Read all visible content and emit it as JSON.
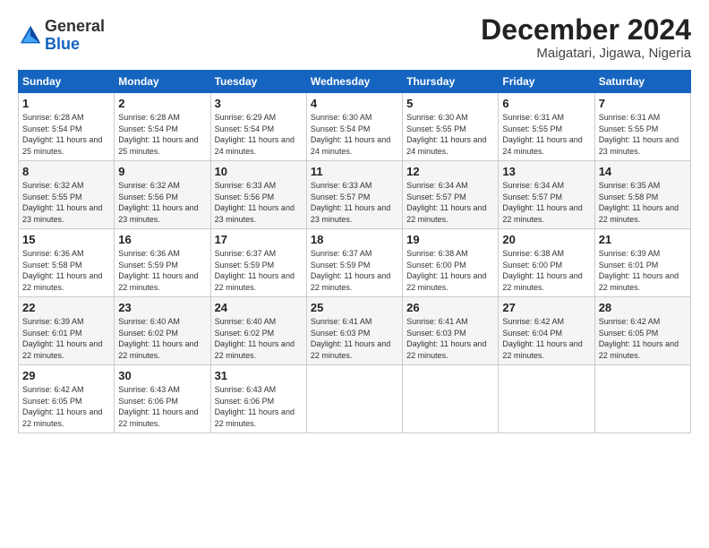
{
  "header": {
    "logo_line1": "General",
    "logo_line2": "Blue",
    "month_title": "December 2024",
    "location": "Maigatari, Jigawa, Nigeria"
  },
  "weekdays": [
    "Sunday",
    "Monday",
    "Tuesday",
    "Wednesday",
    "Thursday",
    "Friday",
    "Saturday"
  ],
  "weeks": [
    [
      {
        "day": "1",
        "sunrise": "6:28 AM",
        "sunset": "5:54 PM",
        "daylight": "11 hours and 25 minutes."
      },
      {
        "day": "2",
        "sunrise": "6:28 AM",
        "sunset": "5:54 PM",
        "daylight": "11 hours and 25 minutes."
      },
      {
        "day": "3",
        "sunrise": "6:29 AM",
        "sunset": "5:54 PM",
        "daylight": "11 hours and 24 minutes."
      },
      {
        "day": "4",
        "sunrise": "6:30 AM",
        "sunset": "5:54 PM",
        "daylight": "11 hours and 24 minutes."
      },
      {
        "day": "5",
        "sunrise": "6:30 AM",
        "sunset": "5:55 PM",
        "daylight": "11 hours and 24 minutes."
      },
      {
        "day": "6",
        "sunrise": "6:31 AM",
        "sunset": "5:55 PM",
        "daylight": "11 hours and 24 minutes."
      },
      {
        "day": "7",
        "sunrise": "6:31 AM",
        "sunset": "5:55 PM",
        "daylight": "11 hours and 23 minutes."
      }
    ],
    [
      {
        "day": "8",
        "sunrise": "6:32 AM",
        "sunset": "5:55 PM",
        "daylight": "11 hours and 23 minutes."
      },
      {
        "day": "9",
        "sunrise": "6:32 AM",
        "sunset": "5:56 PM",
        "daylight": "11 hours and 23 minutes."
      },
      {
        "day": "10",
        "sunrise": "6:33 AM",
        "sunset": "5:56 PM",
        "daylight": "11 hours and 23 minutes."
      },
      {
        "day": "11",
        "sunrise": "6:33 AM",
        "sunset": "5:57 PM",
        "daylight": "11 hours and 23 minutes."
      },
      {
        "day": "12",
        "sunrise": "6:34 AM",
        "sunset": "5:57 PM",
        "daylight": "11 hours and 22 minutes."
      },
      {
        "day": "13",
        "sunrise": "6:34 AM",
        "sunset": "5:57 PM",
        "daylight": "11 hours and 22 minutes."
      },
      {
        "day": "14",
        "sunrise": "6:35 AM",
        "sunset": "5:58 PM",
        "daylight": "11 hours and 22 minutes."
      }
    ],
    [
      {
        "day": "15",
        "sunrise": "6:36 AM",
        "sunset": "5:58 PM",
        "daylight": "11 hours and 22 minutes."
      },
      {
        "day": "16",
        "sunrise": "6:36 AM",
        "sunset": "5:59 PM",
        "daylight": "11 hours and 22 minutes."
      },
      {
        "day": "17",
        "sunrise": "6:37 AM",
        "sunset": "5:59 PM",
        "daylight": "11 hours and 22 minutes."
      },
      {
        "day": "18",
        "sunrise": "6:37 AM",
        "sunset": "5:59 PM",
        "daylight": "11 hours and 22 minutes."
      },
      {
        "day": "19",
        "sunrise": "6:38 AM",
        "sunset": "6:00 PM",
        "daylight": "11 hours and 22 minutes."
      },
      {
        "day": "20",
        "sunrise": "6:38 AM",
        "sunset": "6:00 PM",
        "daylight": "11 hours and 22 minutes."
      },
      {
        "day": "21",
        "sunrise": "6:39 AM",
        "sunset": "6:01 PM",
        "daylight": "11 hours and 22 minutes."
      }
    ],
    [
      {
        "day": "22",
        "sunrise": "6:39 AM",
        "sunset": "6:01 PM",
        "daylight": "11 hours and 22 minutes."
      },
      {
        "day": "23",
        "sunrise": "6:40 AM",
        "sunset": "6:02 PM",
        "daylight": "11 hours and 22 minutes."
      },
      {
        "day": "24",
        "sunrise": "6:40 AM",
        "sunset": "6:02 PM",
        "daylight": "11 hours and 22 minutes."
      },
      {
        "day": "25",
        "sunrise": "6:41 AM",
        "sunset": "6:03 PM",
        "daylight": "11 hours and 22 minutes."
      },
      {
        "day": "26",
        "sunrise": "6:41 AM",
        "sunset": "6:03 PM",
        "daylight": "11 hours and 22 minutes."
      },
      {
        "day": "27",
        "sunrise": "6:42 AM",
        "sunset": "6:04 PM",
        "daylight": "11 hours and 22 minutes."
      },
      {
        "day": "28",
        "sunrise": "6:42 AM",
        "sunset": "6:05 PM",
        "daylight": "11 hours and 22 minutes."
      }
    ],
    [
      {
        "day": "29",
        "sunrise": "6:42 AM",
        "sunset": "6:05 PM",
        "daylight": "11 hours and 22 minutes."
      },
      {
        "day": "30",
        "sunrise": "6:43 AM",
        "sunset": "6:06 PM",
        "daylight": "11 hours and 22 minutes."
      },
      {
        "day": "31",
        "sunrise": "6:43 AM",
        "sunset": "6:06 PM",
        "daylight": "11 hours and 22 minutes."
      },
      null,
      null,
      null,
      null
    ]
  ]
}
